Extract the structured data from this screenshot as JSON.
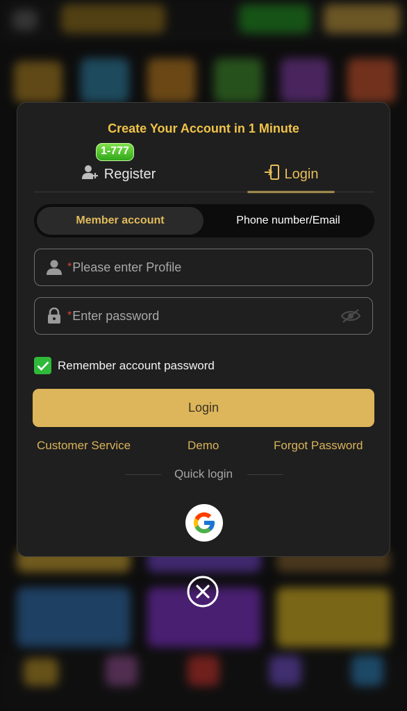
{
  "modal": {
    "title": "Create Your Account in 1 Minute",
    "badge": "1-777",
    "tabs": {
      "register": "Register",
      "login": "Login"
    },
    "segments": {
      "member": "Member account",
      "phone": "Phone number/Email"
    },
    "fields": {
      "profile_placeholder": "Please enter Profile",
      "password_placeholder": "Enter password",
      "required_mark": "*"
    },
    "remember_label": "Remember account password",
    "login_button": "Login",
    "links": {
      "customer_service": "Customer Service",
      "demo": "Demo",
      "forgot": "Forgot Password"
    },
    "quick_login": "Quick login"
  },
  "colors": {
    "accent": "#e3bd5d",
    "title": "#f0c448",
    "badge": "#44c029",
    "checkbox": "#2fba3a",
    "background": "#1f1f1f"
  },
  "icons": [
    "user-add-icon",
    "login-door-icon",
    "user-icon",
    "lock-icon",
    "eye-off-icon",
    "check-icon",
    "google-icon",
    "close-circle-icon"
  ]
}
